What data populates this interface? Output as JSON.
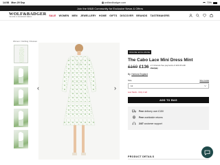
{
  "status_bar": {
    "time": "14:58",
    "date": "Mon 29 Sep",
    "url": "wolfandbadger.com",
    "battery": "70%"
  },
  "promo": {
    "text": "Join the W&B Community for Exclusive News & Offers"
  },
  "header": {
    "logo": "WOLF&BADGER",
    "logo_tagline": "THE HOME OF INDEPENDENT BRANDS",
    "nav": [
      {
        "label": "SALE"
      },
      {
        "label": "WOMEN"
      },
      {
        "label": "MEN"
      },
      {
        "label": "JEWELLERY"
      },
      {
        "label": "HOME"
      },
      {
        "label": "GIFTS"
      },
      {
        "label": "DISCOVER"
      },
      {
        "label": "BRANDS"
      },
      {
        "label": "TASTEMAKERS"
      }
    ],
    "icons": [
      "user-icon",
      "search-icon",
      "heart-icon",
      "bag-icon"
    ]
  },
  "breadcrumb": "Women / Clothing / Dresses",
  "gallery": {
    "thumbnail_count": 5
  },
  "product": {
    "badge": "ONLINE EXCLUSIVE",
    "title": "The Cabo Lace Mini Dress Mint",
    "price_old": "£169",
    "price_new": "£136",
    "klarna_text": "or 4 interest-free payments of £34.00 with",
    "clearpay_text": "clearpay",
    "brand_prefix": "By",
    "brand_name": "Hortons England",
    "size_label": "Size",
    "size_guide": "Size Guide",
    "size_value": "12",
    "stock_text": "Low Stock - Only 1 left",
    "add_to_bag": "ADD TO BAG"
  },
  "benefits": [
    {
      "icon": "truck-icon",
      "bold": "Free",
      "text": "delivery over £150"
    },
    {
      "icon": "return-icon",
      "bold": "Free",
      "text": "worldwide returns"
    },
    {
      "icon": "headset-icon",
      "bold": "24/7",
      "text": "customer support"
    }
  ],
  "details_heading": "PRODUCT DETAILS",
  "colors": {
    "accent": "#c8102e",
    "button": "#111111",
    "chat": "#1f4a4a",
    "promo_bg": "#1b1b1b"
  }
}
